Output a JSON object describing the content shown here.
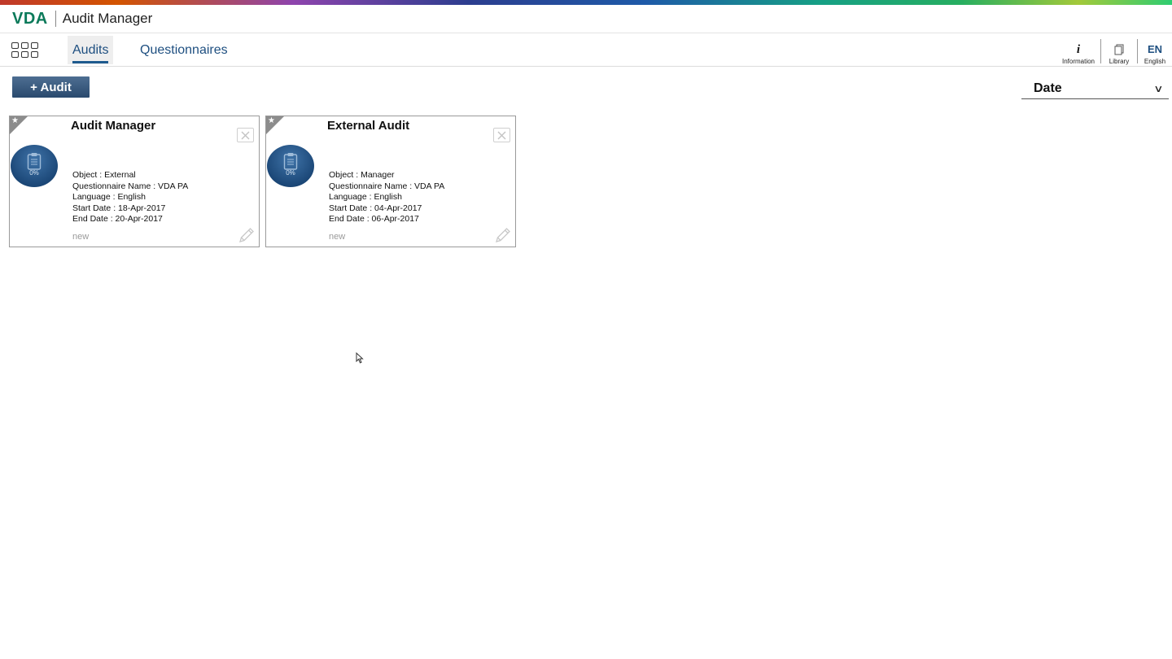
{
  "header": {
    "brand": "VDA",
    "app_title": "Audit Manager"
  },
  "nav": {
    "tabs": [
      {
        "label": "Audits",
        "active": true
      },
      {
        "label": "Questionnaires",
        "active": false
      }
    ],
    "tools": {
      "information": {
        "glyph": "i",
        "label": "Information",
        "icon": "info-icon"
      },
      "library": {
        "label": "Library",
        "icon": "library-icon"
      },
      "language": {
        "code": "EN",
        "label": "English"
      }
    }
  },
  "toolbar": {
    "add_audit_label": "+ Audit",
    "sort_value": "Date"
  },
  "colors": {
    "brand_green": "#0b7a5a",
    "accent_blue": "#1e4f80",
    "button_blue": "#2a4a6e"
  },
  "audits": [
    {
      "title": "Audit Manager",
      "progress": "0%",
      "object": "Object : External",
      "questionnaire": "Questionnaire Name : VDA PA",
      "language": "Language : English",
      "start_date": "Start Date : 18-Apr-2017",
      "end_date": "End Date : 20-Apr-2017",
      "status": "new"
    },
    {
      "title": "External Audit",
      "progress": "0%",
      "object": "Object : Manager",
      "questionnaire": "Questionnaire Name : VDA PA",
      "language": "Language : English",
      "start_date": "Start Date : 04-Apr-2017",
      "end_date": "End Date : 06-Apr-2017",
      "status": "new"
    }
  ]
}
